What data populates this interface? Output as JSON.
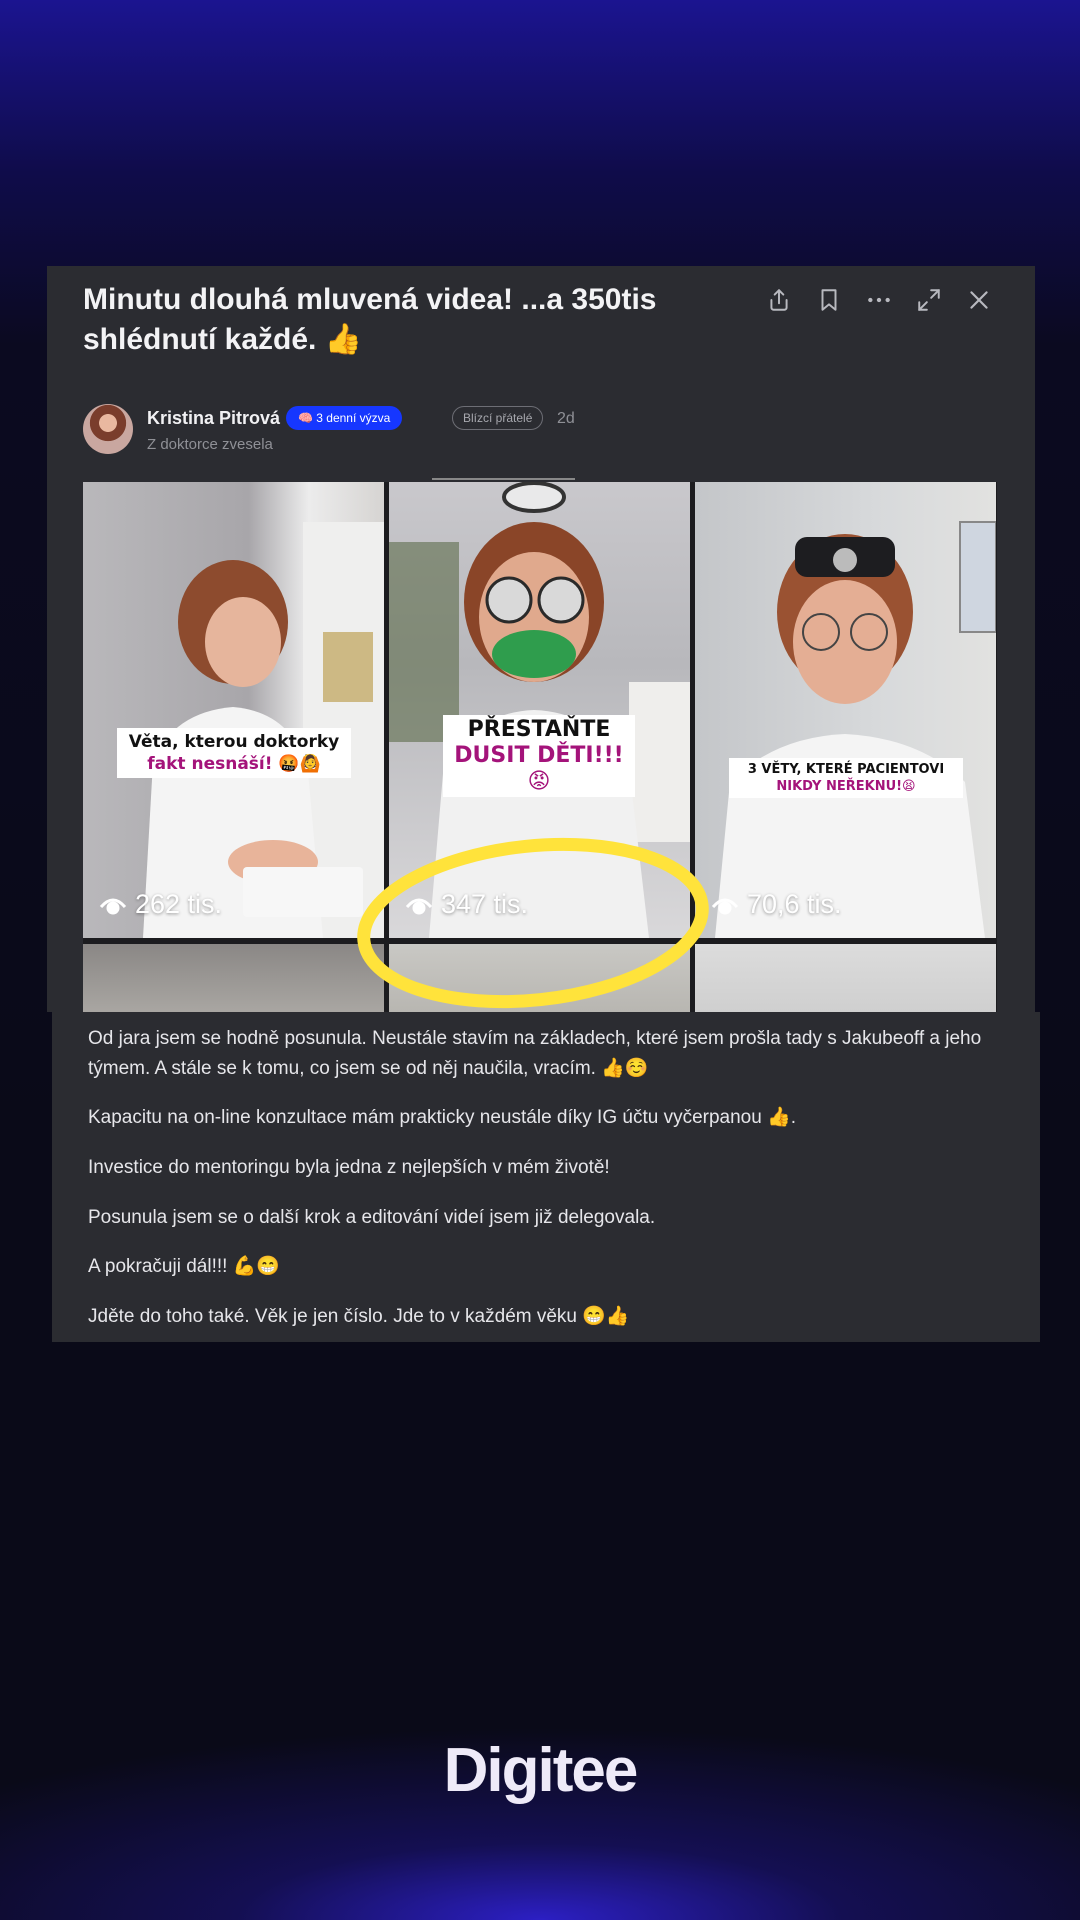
{
  "post": {
    "title_line1": "Minutu dlouhá mluvená videa! ...a 350tis",
    "title_line2": "shlédnutí každé. 👍",
    "toolbar": {
      "share": "share-icon",
      "bookmark": "bookmark-icon",
      "more": "more-icon",
      "expand": "expand-icon",
      "close": "close-icon"
    },
    "author": {
      "name": "Kristina Pitrová",
      "badge": "🧠 3 denní výzva",
      "badge_color": "#1637ff",
      "group": "Blízcí přátelé",
      "time": "2d",
      "community": "Z doktorce zvesela"
    },
    "videos": [
      {
        "caption_line1": "Věta, kterou doktorky",
        "caption_line2": "fakt nesnáší! 🤬🙆",
        "views": "262 tis."
      },
      {
        "caption_line1": "PŘESTAŇTE",
        "caption_line2": "DUSIT DĚTI!!!😡",
        "views": "347 tis."
      },
      {
        "caption_line1": "3 VĚTY, KTERÉ PACIENTOVI",
        "caption_line2": "NIKDY NEŘEKNU!😫",
        "views": "70,6 tis."
      }
    ],
    "highlight_color": "#ffe33b",
    "body": [
      "Od jara jsem se hodně posunula. Neustále stavím na základech, které jsem prošla tady s Jakubeoff a jeho týmem. A stále se k tomu, co jsem se od něj naučila, vracím. 👍☺️",
      "Kapacitu na on-line konzultace mám prakticky neustále díky IG účtu vyčerpanou 👍.",
      "Investice do mentoringu byla jedna z nejlepších v mém životě!",
      "Posunula jsem se o další krok a editování videí jsem již delegovala.",
      "A pokračuji dál!!! 💪😁",
      "Jděte do toho také. Věk je jen číslo. Jde to v každém věku 😁👍"
    ]
  },
  "brand": {
    "logo": "Digitee"
  }
}
